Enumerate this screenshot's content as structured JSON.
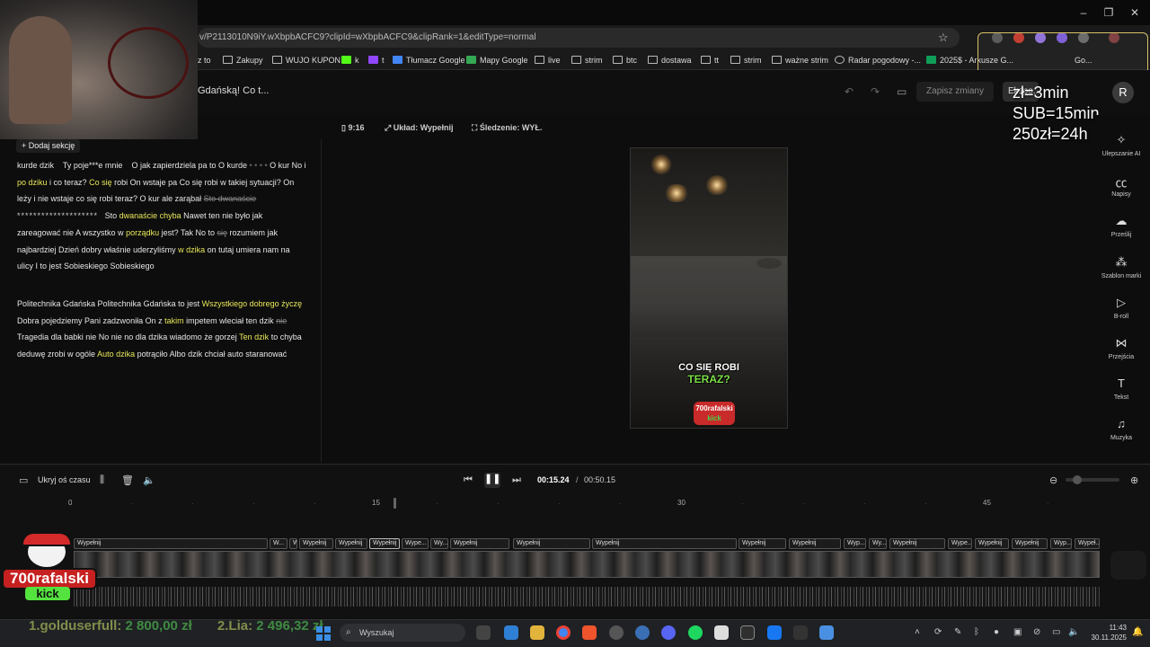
{
  "browser": {
    "url": "v/P2113010N9iY.wXbpbACFC9?clipId=wXbpbACFC9&clipRank=1&editType=normal",
    "bookmarks": [
      {
        "label": "z to"
      },
      {
        "label": "Zakupy"
      },
      {
        "label": "WUJO KUPON"
      },
      {
        "label": "k"
      },
      {
        "label": "t"
      },
      {
        "label": "Tłumacz Google"
      },
      {
        "label": "Mapy Google"
      },
      {
        "label": "live"
      },
      {
        "label": "strim"
      },
      {
        "label": "btc"
      },
      {
        "label": "dostawa"
      },
      {
        "label": "tt"
      },
      {
        "label": "strim"
      },
      {
        "label": "ważne strim"
      },
      {
        "label": "Radar pogodowy -..."
      },
      {
        "label": "2025$ - Arkusze G..."
      },
      {
        "label": "Go..."
      }
    ],
    "window_controls": {
      "minimize": "–",
      "restore": "❐",
      "close": "✕"
    }
  },
  "editor": {
    "project_title": "Gdańską! Co t...",
    "save_label": "Zapisz zmiany",
    "export_label": "Ekspo...",
    "avatar_initial": "R",
    "add_section_label": "+  Dodaj sekcję",
    "aspect_label": "9:16",
    "layout_label": "Układ: Wypełnij",
    "tracking_label": "Śledzenie: WYŁ.",
    "caption_line1": "CO SIĘ ROBI",
    "caption_line2": "TERAZ?",
    "video_logo_top": "700rafalski",
    "video_logo_bottom": "kick"
  },
  "overlay_prices": {
    "line1": "zł=3min",
    "line2": "SUB=15min",
    "line3": "250zł=24h"
  },
  "transcript": {
    "p1": {
      "s1": "kurde dzik",
      "s2": "Ty poje***e mnie",
      "s3": "O jak zapierdziela pa to O kurde",
      "s4": "• • • •",
      "s5": "O kur No i",
      "s6": "po dziku",
      "s7": "i co teraz?",
      "s8": "Co się",
      "s9": "robi On wstaje pa Co się robi w takiej sytuacji? On leży i nie wstaje co się robi teraz? O kur ale zarąbał",
      "s10": "Sto dwanaście",
      "s11": "********************",
      "s12": "Sto",
      "s13": "dwanaście chyba",
      "s14": "Nawet ten nie było jak zareagować nie A wszystko w",
      "s15": "porządku",
      "s16": "jest? Tak No to",
      "s17": "się",
      "s18": "rozumiem jak najbardziej Dzień dobry właśnie uderzyliśmy",
      "s19": "w dzika",
      "s20": "on tutaj umiera nam na ulicy I to jest Sobieskiego Sobieskiego"
    },
    "p2": {
      "s1": "Politechnika Gdańska Politechnika Gdańska to jest",
      "s2": "Wszystkiego dobrego życzę",
      "s3": "Dobra pojedziemy Pani zadzwoniła On z",
      "s4": "takim",
      "s5": "impetem wleciał ten dzik",
      "s6": "nie",
      "s7": "Tragedia dla babki nie No nie no dla dzika wiadomo że gorzej",
      "s8": "Ten dzik",
      "s9": "to chyba deduwę zrobi w ogóle",
      "s10": "Auto dzika",
      "s11": "potrąciło Albo dzik chciał auto staranować"
    }
  },
  "tools": [
    {
      "label": "Ulepszanie AI",
      "icon": "sparkle-icon"
    },
    {
      "label": "Napisy",
      "icon": "captions-icon"
    },
    {
      "label": "Prześlij",
      "icon": "upload-icon"
    },
    {
      "label": "Szablon marki",
      "icon": "brand-template-icon"
    },
    {
      "label": "B-roll",
      "icon": "broll-icon"
    },
    {
      "label": "Przejścia",
      "icon": "transitions-icon"
    },
    {
      "label": "Tekst",
      "icon": "text-icon"
    },
    {
      "label": "Muzyka",
      "icon": "music-icon"
    }
  ],
  "timeline": {
    "hide_label": "Ukryj oś czasu",
    "current_time": "00:15.24",
    "separator": "/",
    "total_time": "00:50.15",
    "ruler": [
      "0",
      "15",
      "30",
      "45"
    ],
    "segments": [
      "Wypełnij",
      "W...",
      "W...",
      "Wypełnij",
      "Wypełnij",
      "Wypełnij",
      "Wype...",
      "Wy...",
      "Wypełnij",
      "Wypełnij",
      "Wypełnij",
      "Wypełnij",
      "Wypełnij",
      "Wyp...",
      "Wy...",
      "Wypełnij",
      "Wype...",
      "Wypełnij",
      "Wypełnij",
      "Wyp...",
      "Wypeł..."
    ]
  },
  "stream_overlay": {
    "logo_name": "700rafalski",
    "logo_sub": "kick",
    "ticker_1_name": "1.golduserfull:",
    "ticker_1_amount": "2 800,00 zł",
    "ticker_2_name": "2.Lia:",
    "ticker_2_amount": "2 496,32 zł"
  },
  "taskbar": {
    "search_placeholder": "Wyszukaj",
    "time": "11:43",
    "date": "30.11.2025"
  },
  "colors": {
    "highlight": "#e8e85a",
    "caption_green": "#7ee04a",
    "kick_green": "#54e23f",
    "brand_red": "#c62020"
  }
}
